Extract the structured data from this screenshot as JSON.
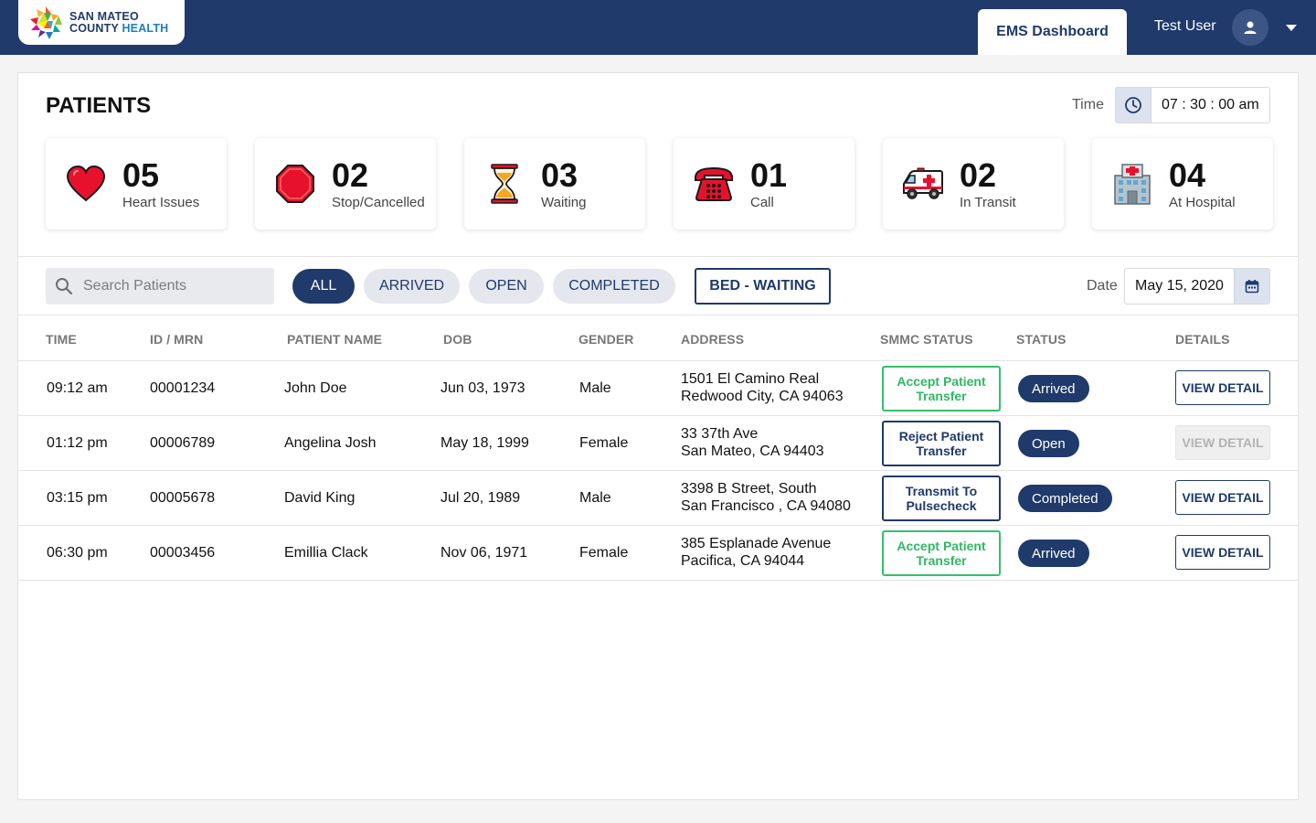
{
  "header": {
    "logo_line1": "SAN MATEO",
    "logo_line2a": "COUNTY ",
    "logo_line2b": "HEALTH",
    "active_tab": "EMS Dashboard",
    "user_name": "Test User"
  },
  "page": {
    "title": "PATIENTS",
    "time_label": "Time",
    "time_value": "07 : 30 : 00 am"
  },
  "stats": [
    {
      "icon": "heart-icon",
      "count": "05",
      "label": "Heart Issues"
    },
    {
      "icon": "stop-sign-icon",
      "count": "02",
      "label": "Stop/Cancelled"
    },
    {
      "icon": "hourglass-icon",
      "count": "03",
      "label": "Waiting"
    },
    {
      "icon": "telephone-icon",
      "count": "01",
      "label": "Call"
    },
    {
      "icon": "ambulance-icon",
      "count": "02",
      "label": "In Transit"
    },
    {
      "icon": "hospital-icon",
      "count": "04",
      "label": "At Hospital"
    }
  ],
  "filters": {
    "search_placeholder": "Search Patients",
    "pills": [
      "ALL",
      "ARRIVED",
      "OPEN",
      "COMPLETED"
    ],
    "active_pill": "ALL",
    "bed_button": "BED - WAITING",
    "date_label": "Date",
    "date_value": "May 15, 2020"
  },
  "table": {
    "columns": [
      "TIME",
      "ID / MRN",
      "PATIENT NAME",
      "DOB",
      "GENDER",
      "ADDRESS",
      "SMMC STATUS",
      "STATUS",
      "DETAILS"
    ],
    "rows": [
      {
        "time": "09:12 am",
        "id": "00001234",
        "name": "John Doe",
        "dob": "Jun 03, 1973",
        "gender": "Male",
        "addr1": "1501 El Camino Real",
        "addr2": "Redwood City, CA 94063",
        "smmc": "Accept Patient Transfer",
        "smmc_style": "green",
        "status": "Arrived",
        "details": "VIEW DETAIL",
        "details_enabled": true
      },
      {
        "time": "01:12 pm",
        "id": "00006789",
        "name": "Angelina Josh",
        "dob": "May 18, 1999",
        "gender": "Female",
        "addr1": "33 37th Ave",
        "addr2": "San Mateo, CA 94403",
        "smmc": "Reject Patient Transfer",
        "smmc_style": "navy",
        "status": "Open",
        "details": "VIEW DETAIL",
        "details_enabled": false
      },
      {
        "time": "03:15 pm",
        "id": "00005678",
        "name": "David King",
        "dob": "Jul 20, 1989",
        "gender": "Male",
        "addr1": "3398 B Street, South",
        "addr2": "San Francisco , CA 94080",
        "smmc": "Transmit To Pulsecheck",
        "smmc_style": "navy",
        "status": "Completed",
        "details": "VIEW DETAIL",
        "details_enabled": true
      },
      {
        "time": "06:30 pm",
        "id": "00003456",
        "name": "Emillia Clack",
        "dob": "Nov 06, 1971",
        "gender": "Female",
        "addr1": "385 Esplanade Avenue",
        "addr2": "Pacifica, CA 94044",
        "smmc": "Accept Patient Transfer",
        "smmc_style": "green",
        "status": "Arrived",
        "details": "VIEW DETAIL",
        "details_enabled": true
      }
    ]
  },
  "colors": {
    "brand_navy": "#1f3a6b",
    "accept_green": "#2fb864"
  }
}
